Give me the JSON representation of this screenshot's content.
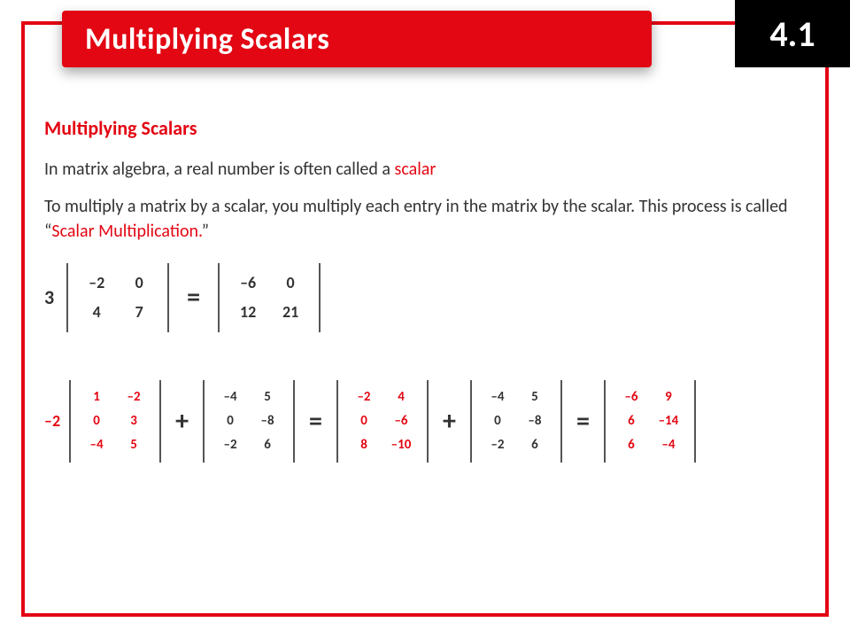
{
  "header": {
    "title": "Multiplying Scalars",
    "section": "4.1"
  },
  "content": {
    "subhead": "Multiplying Scalars",
    "line1a": "In matrix algebra, a real number is often called a ",
    "line1b": "scalar",
    "line2a": "To multiply a matrix by a scalar, you multiply each entry in the matrix by the scalar.  This process is called “",
    "line2b": "Scalar Multiplication.",
    "line2c": "”"
  },
  "eq1": {
    "scalar": "3",
    "A": [
      [
        "–2",
        "0"
      ],
      [
        "4",
        "7"
      ]
    ],
    "eq": "=",
    "R": [
      [
        "–6",
        "0"
      ],
      [
        "12",
        "21"
      ]
    ]
  },
  "eq2": {
    "scalar": "–2",
    "A": [
      [
        "1",
        "–2"
      ],
      [
        "0",
        "3"
      ],
      [
        "–4",
        "5"
      ]
    ],
    "plus": "+",
    "B": [
      [
        "–4",
        "5"
      ],
      [
        "0",
        "–8"
      ],
      [
        "–2",
        "6"
      ]
    ],
    "eq": "=",
    "C": [
      [
        "–2",
        "4"
      ],
      [
        "0",
        "–6"
      ],
      [
        "8",
        "–10"
      ]
    ],
    "D": [
      [
        "–4",
        "5"
      ],
      [
        "0",
        "–8"
      ],
      [
        "–2",
        "6"
      ]
    ],
    "R": [
      [
        "–6",
        "9"
      ],
      [
        "6",
        "–14"
      ],
      [
        "6",
        "–4"
      ]
    ]
  }
}
